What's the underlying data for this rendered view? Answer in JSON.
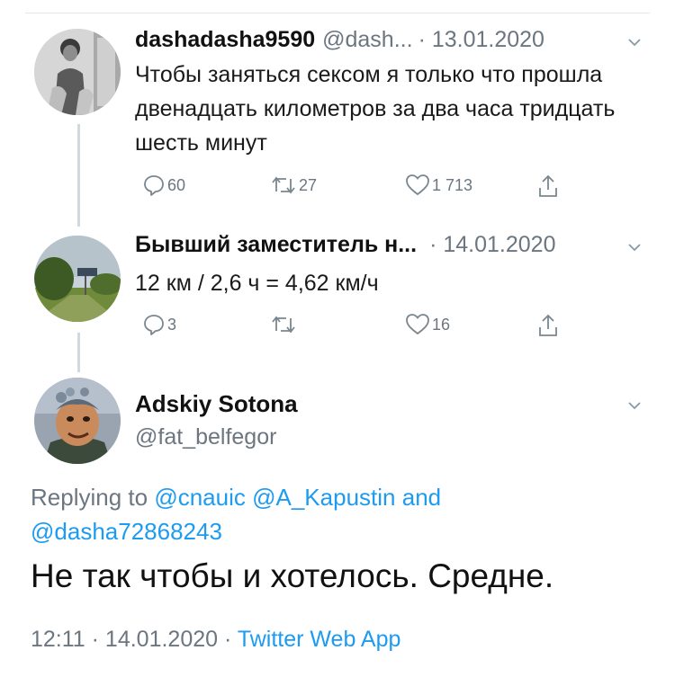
{
  "tweets": [
    {
      "name": "dashadasha9590",
      "handle": "@dash...",
      "date": "· 13.01.2020",
      "text": "Чтобы заняться сексом я только что прошла двенадцать километров за два часа тридцать шесть минут",
      "replies": "60",
      "retweets": "27",
      "likes": "1 713"
    },
    {
      "name": "Бывший заместитель н...",
      "date": "· 14.01.2020",
      "text": "12 км / 2,6 ч = 4,62 км/ч",
      "replies": "3",
      "retweets": "",
      "likes": "16"
    }
  ],
  "main": {
    "name": "Adskiy Sotona",
    "handle": "@fat_belfegor",
    "replying_to": "Replying to",
    "mention1": "@cnauic",
    "mention2": "@A_Kapustin",
    "and": "and",
    "mention3": "@dasha72868243",
    "text": "Не так чтобы и хотелось. Средне.",
    "time": "12:11 · 14.01.2020 ·",
    "app": "Twitter Web App"
  },
  "icons": {
    "reply": "reply-icon",
    "retweet": "retweet-icon",
    "like": "heart-icon",
    "share": "share-icon",
    "more": "chevron-down-icon"
  },
  "colors": {
    "link": "#1d9bf0",
    "muted": "#6b7680",
    "thread_line": "#cfd9de"
  }
}
